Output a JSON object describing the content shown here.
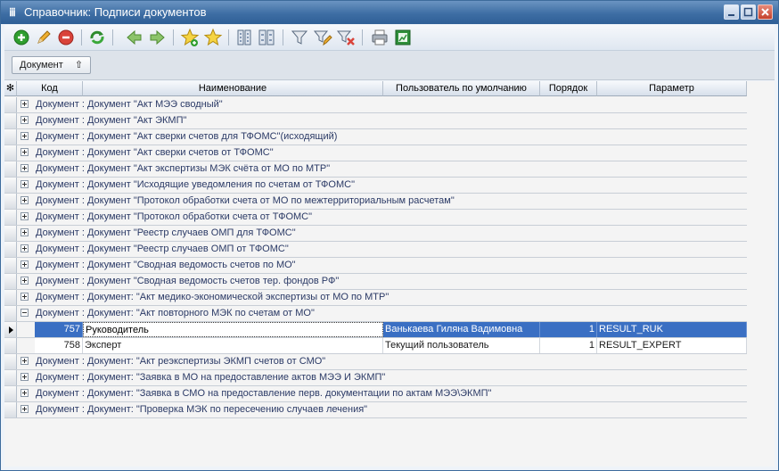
{
  "window": {
    "title": "Справочник: Подписи документов"
  },
  "toolbar": {
    "buttons": [
      "add-icon",
      "edit-icon",
      "delete-icon",
      "refresh-icon",
      "back-icon",
      "forward-icon",
      "favorite-add-icon",
      "favorite-icon",
      "collapse-icon",
      "expand-icon",
      "filter-icon",
      "filter-edit-icon",
      "filter-clear-icon",
      "print-icon",
      "export-excel-icon"
    ]
  },
  "group_panel": {
    "button_label": "Документ",
    "sort_indicator": "⇧"
  },
  "columns": [
    "Код",
    "Наименование",
    "Пользователь по умолчанию",
    "Порядок",
    "Параметр"
  ],
  "header_corner": "✻",
  "groups_before": [
    "Документ : Документ \"Акт МЭЭ сводный\"",
    "Документ : Документ \"Акт ЭКМП\"",
    "Документ : Документ \"Акт сверки счетов для ТФОМС\"(исходящий)",
    "Документ : Документ \"Акт сверки счетов от ТФОМС\"",
    "Документ : Документ \"Акт экспертизы МЭК счёта от МО по МТР\"",
    "Документ : Документ \"Исходящие уведомления по счетам от ТФОМС\"",
    "Документ : Документ \"Протокол обработки счета от МО по межтерриториальным расчетам\"",
    "Документ : Документ \"Протокол обработки счета от ТФОМС\"",
    "Документ : Документ \"Реестр случаев ОМП для ТФОМС\"",
    "Документ : Документ \"Реестр случаев ОМП от ТФОМС\"",
    "Документ : Документ \"Сводная ведомость счетов по МО\"",
    "Документ : Документ \"Сводная ведомость счетов тер. фондов РФ\"",
    "Документ : Документ: \"Акт медико-экономической экспертизы от МО по МТР\""
  ],
  "expanded_group": "Документ : Документ: \"Акт повторного МЭК по счетам от МО\"",
  "rows": [
    {
      "code": "757",
      "name": "Руководитель",
      "user": "Ванькаева Гиляна Вадимовна",
      "order": "1",
      "param": "RESULT_RUK"
    },
    {
      "code": "758",
      "name": "Эксперт",
      "user": "Текущий пользователь",
      "order": "1",
      "param": "RESULT_EXPERT"
    }
  ],
  "groups_after": [
    "Документ : Документ: \"Акт реэкспертизы ЭКМП счетов от СМО\"",
    "Документ : Документ: \"Заявка в МО на предоставление актов МЭЭ И ЭКМП\"",
    "Документ : Документ: \"Заявка в СМО на предоставление перв. документации по актам МЭЭ\\ЭКМП\"",
    "Документ : Документ: \"Проверка МЭК по пересечению случаев лечения\""
  ]
}
